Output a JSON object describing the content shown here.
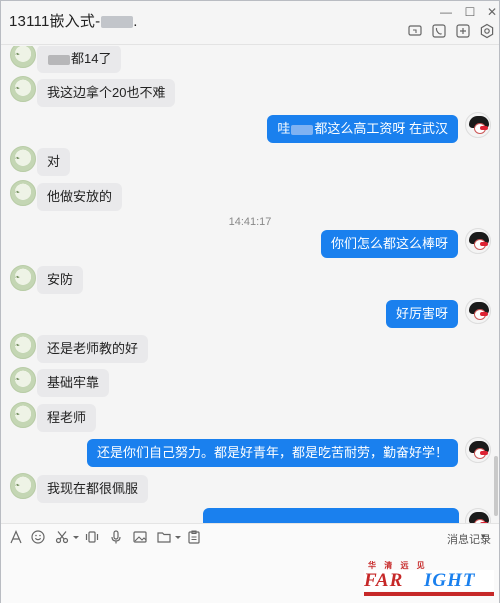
{
  "window": {
    "title_prefix": "13111嵌入式-",
    "title_suffix": ".",
    "controls": {
      "minimize": "—",
      "restore": "☐",
      "close": "✕"
    }
  },
  "toolbar": {
    "icons": [
      "screen-share-icon",
      "voice-call-icon",
      "add-member-icon",
      "settings-icon"
    ]
  },
  "chat": {
    "timestamp": "14:41:17",
    "messages": [
      {
        "side": "in",
        "prefix": "",
        "text": "都14了",
        "blurred_prefix": true
      },
      {
        "side": "in",
        "text": "我这边拿个20也不难"
      },
      {
        "side": "out",
        "prefix": "哇",
        "text": "都这么高工资呀 在武汉",
        "blurred_mid": true
      },
      {
        "side": "in",
        "text": "对"
      },
      {
        "side": "in",
        "text": "他做安放的"
      },
      {
        "side": "out",
        "text": "你们怎么都这么棒呀"
      },
      {
        "side": "in",
        "text": "安防"
      },
      {
        "side": "out",
        "text": "好厉害呀"
      },
      {
        "side": "in",
        "text": "还是老师教的好"
      },
      {
        "side": "in",
        "text": "基础牢靠"
      },
      {
        "side": "in",
        "text": "程老师"
      },
      {
        "side": "out",
        "text": "还是你们自己努力。都是好青年，都是吃苦耐劳，勤奋好学！"
      },
      {
        "side": "in",
        "text": "我现在都很佩服"
      }
    ]
  },
  "inputbar": {
    "history_label": "消息记录",
    "history_caret": "▾",
    "icons": [
      "font-icon",
      "emoji-icon",
      "scissors-icon",
      "shake-icon",
      "mic-icon",
      "image-icon",
      "folder-icon",
      "clipboard-icon"
    ]
  },
  "watermark": {
    "top": "华 清 远 见",
    "far": "FAR",
    "sight": "IGHT"
  },
  "colors": {
    "accent": "#1a80ee",
    "incoming": "#e9e9eb",
    "watermark_red": "#c62828"
  }
}
